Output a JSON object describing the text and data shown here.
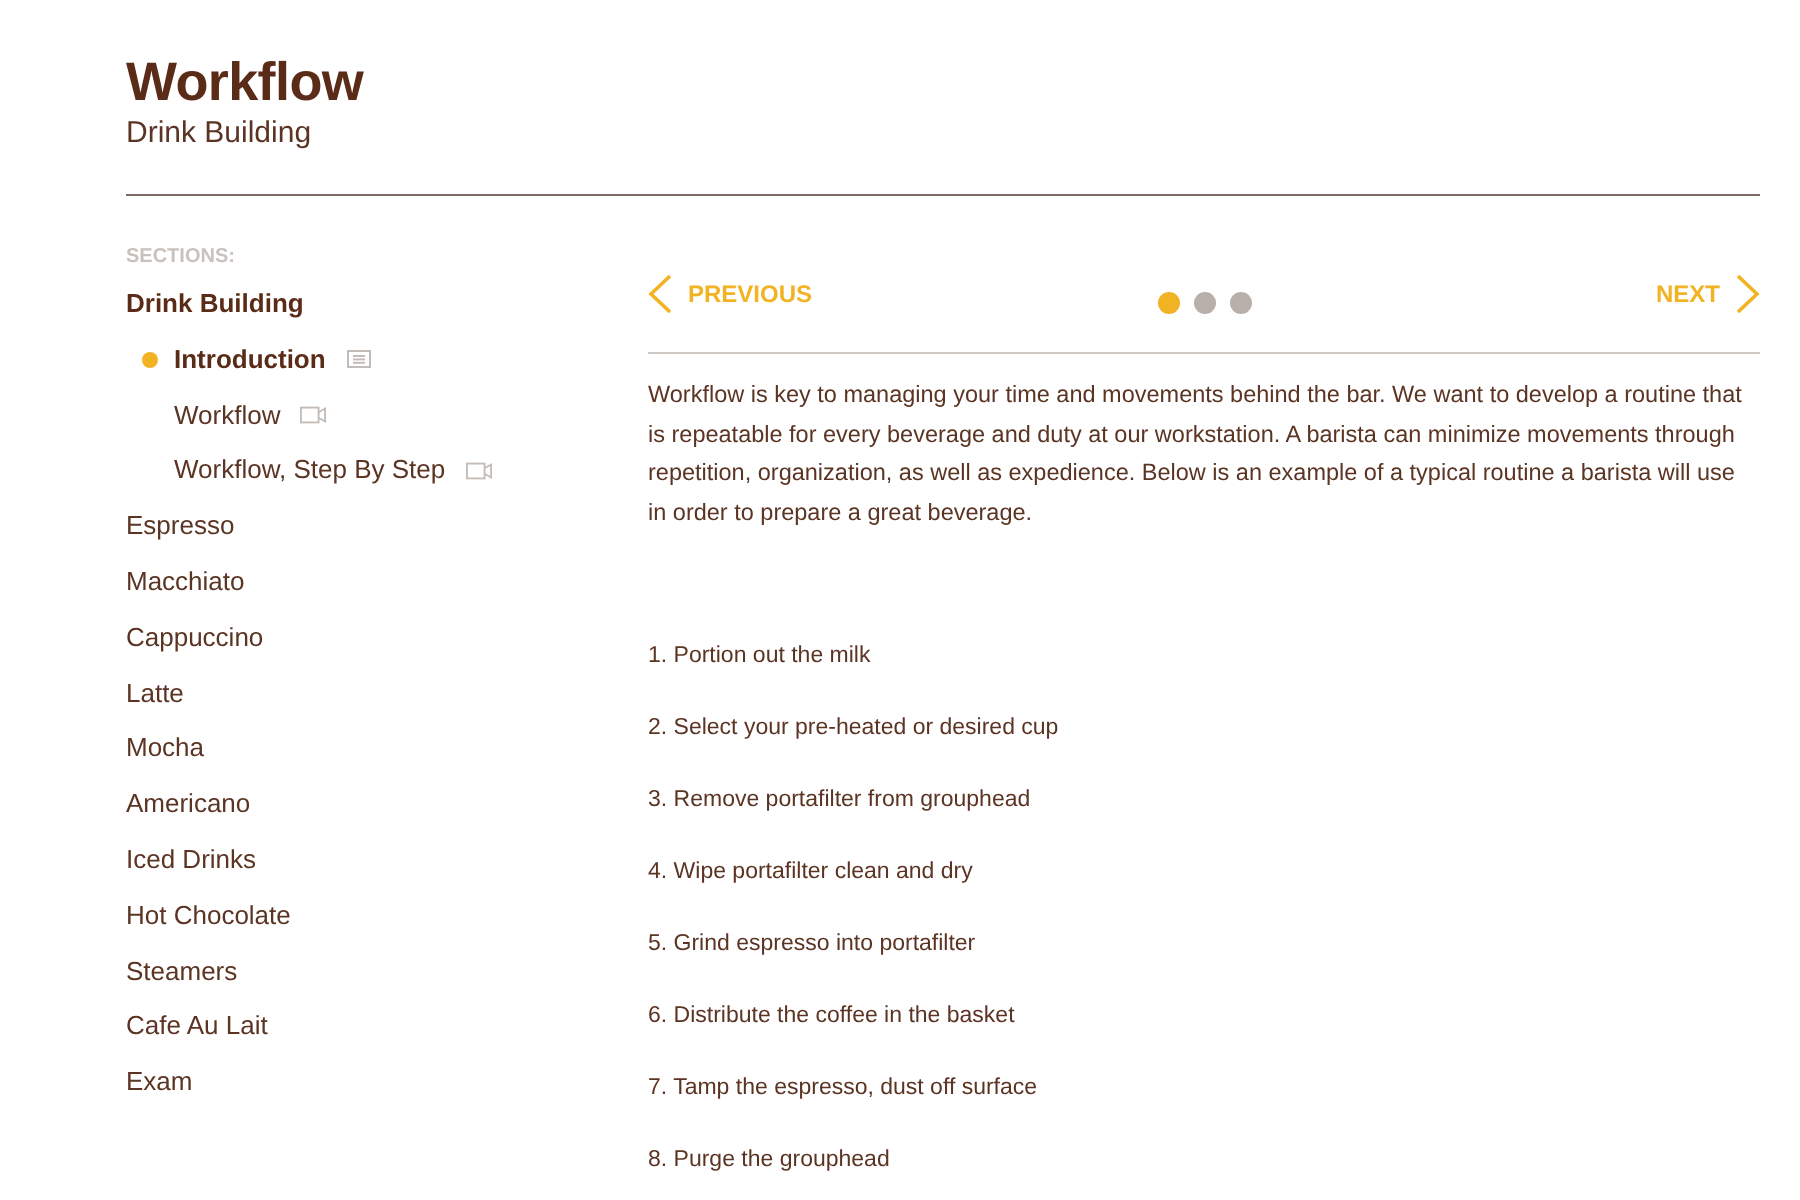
{
  "header": {
    "title": "Workflow",
    "subtitle": "Drink Building"
  },
  "sidebar": {
    "heading": "SECTIONS:",
    "sections": [
      {
        "label": "Drink Building",
        "expanded": true,
        "children": [
          {
            "label": "Introduction",
            "kind": "text",
            "selected": true
          },
          {
            "label": "Workflow",
            "kind": "video",
            "selected": false
          },
          {
            "label": "Workflow, Step By Step",
            "kind": "video",
            "selected": false
          }
        ]
      },
      {
        "label": "Espresso",
        "expanded": false
      },
      {
        "label": "Macchiato",
        "expanded": false
      },
      {
        "label": "Cappuccino",
        "expanded": false
      },
      {
        "label": "Latte",
        "expanded": false
      },
      {
        "label": "Mocha",
        "expanded": false
      },
      {
        "label": "Americano",
        "expanded": false
      },
      {
        "label": "Iced Drinks",
        "expanded": false
      },
      {
        "label": "Hot Chocolate",
        "expanded": false
      },
      {
        "label": "Steamers",
        "expanded": false
      },
      {
        "label": "Cafe Au Lait",
        "expanded": false
      },
      {
        "label": "Exam",
        "expanded": false
      }
    ]
  },
  "pager": {
    "previous": "PREVIOUS",
    "next": "NEXT",
    "dots": [
      {
        "selected": true
      },
      {
        "selected": false
      },
      {
        "selected": false
      }
    ]
  },
  "content": {
    "intro": "Workflow is key to managing your time and movements behind the bar. We want to develop a routine that is repeatable for every beverage and duty at our workstation. A barista can minimize movements through repetition, organization, as well as expedience. Below is an example of a typical routine a barista will use in order to prepare a great beverage.",
    "steps": [
      "1. Portion out the milk",
      "2. Select your pre-heated or desired cup",
      "3. Remove portafilter from grouphead",
      "4. Wipe portafilter clean and dry",
      "5. Grind espresso into portafilter",
      "6. Distribute the coffee in the basket",
      "7. Tamp the espresso, dust off surface",
      "8. Purge the grouphead"
    ]
  }
}
